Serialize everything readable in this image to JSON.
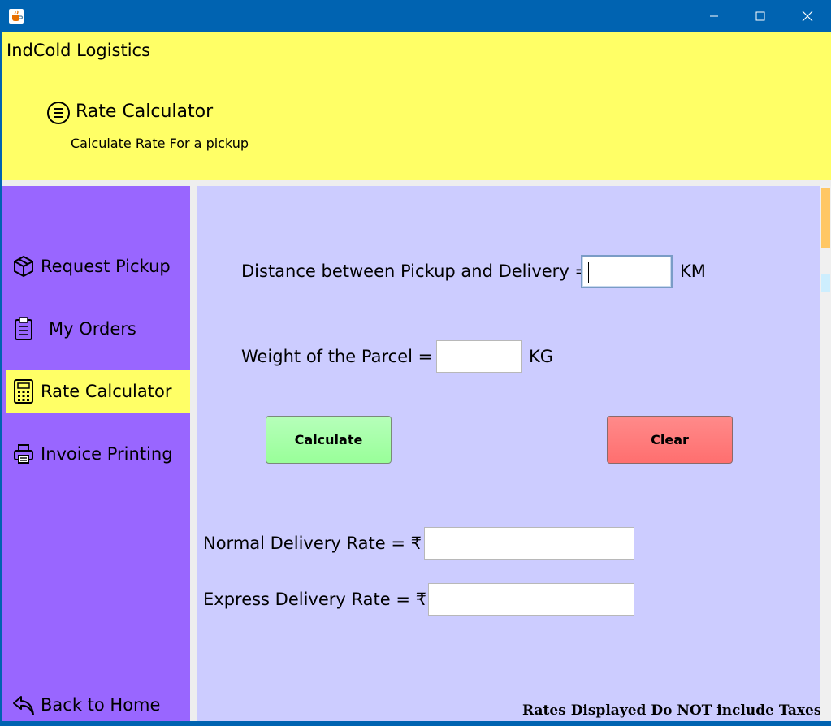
{
  "window": {
    "app_icon": "java-cup-icon",
    "controls": [
      "minimize-icon",
      "maximize-icon",
      "close-icon"
    ]
  },
  "header": {
    "app_title": "IndCold Logistics",
    "section_title": "Rate Calculator",
    "section_subtitle": "Calculate Rate For a pickup",
    "section_icon": "list-circle-icon"
  },
  "sidebar": {
    "items": [
      {
        "label": "Request Pickup",
        "icon": "package-icon",
        "active": false
      },
      {
        "label": "My Orders",
        "icon": "clipboard-icon",
        "active": false
      },
      {
        "label": "Rate Calculator",
        "icon": "calculator-icon",
        "active": true
      },
      {
        "label": "Invoice Printing",
        "icon": "printer-icon",
        "active": false
      }
    ],
    "back": {
      "label": "Back to Home",
      "icon": "back-arrow-icon"
    }
  },
  "form": {
    "distance_label": "Distance between Pickup and Delivery =",
    "distance_value": "",
    "distance_unit": "KM",
    "weight_label": "Weight of the Parcel =",
    "weight_value": "",
    "weight_unit": "KG",
    "calculate_label": "Calculate",
    "clear_label": "Clear",
    "normal_rate_label": "Normal Delivery Rate = ₹",
    "normal_rate_value": "",
    "express_rate_label": "Express Delivery Rate = ₹",
    "express_rate_value": "",
    "note": "Rates Displayed Do NOT include Taxes"
  },
  "colors": {
    "titlebar": "#0063b1",
    "header": "#ffff66",
    "sidebar": "#9966ff",
    "active_item": "#ffff66",
    "main": "#ccccff",
    "calculate_button": "#99ff99",
    "clear_button": "#ff6f6f"
  }
}
